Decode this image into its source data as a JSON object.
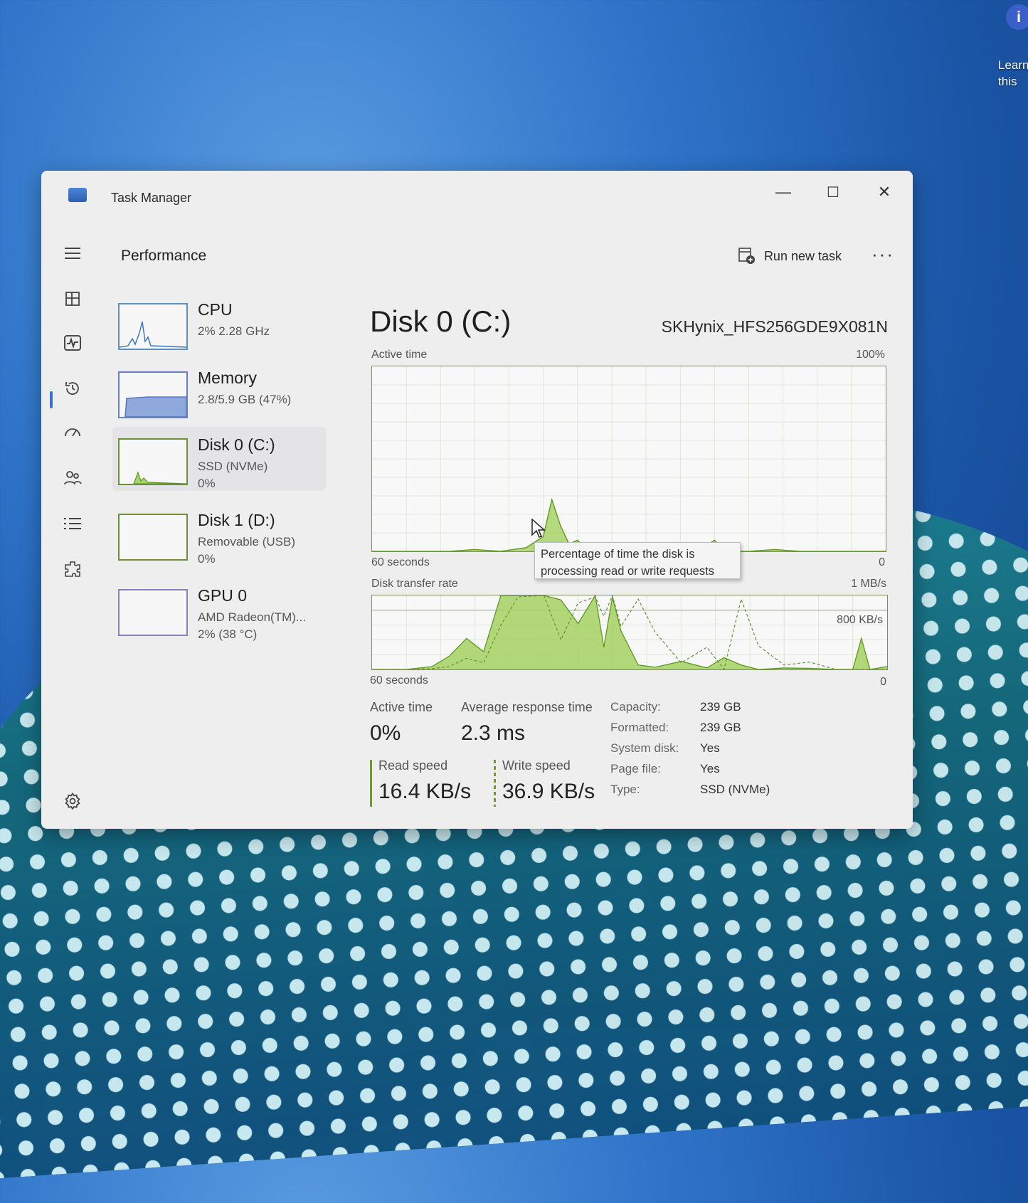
{
  "desktop": {
    "icon": {
      "glyph": "i",
      "label_line1": "Learn",
      "label_line2": "this"
    }
  },
  "window": {
    "title": "Task Manager",
    "controls": {
      "minimize": "—",
      "maximize": "☐",
      "close": "✕"
    }
  },
  "header": {
    "page_title": "Performance",
    "run_new_task": "Run new task",
    "more": "···"
  },
  "nav": {
    "items": [
      "menu-icon",
      "processes-icon",
      "performance-icon",
      "app-history-icon",
      "startup-apps-icon",
      "users-icon",
      "details-icon",
      "services-icon",
      "settings-icon"
    ]
  },
  "resources": [
    {
      "name": "CPU",
      "line1": "2%  2.28 GHz",
      "line2": ""
    },
    {
      "name": "Memory",
      "line1": "2.8/5.9 GB (47%)",
      "line2": ""
    },
    {
      "name": "Disk 0 (C:)",
      "line1": "SSD (NVMe)",
      "line2": "0%"
    },
    {
      "name": "Disk 1 (D:)",
      "line1": "Removable (USB)",
      "line2": "0%"
    },
    {
      "name": "GPU 0",
      "line1": "AMD Radeon(TM)...",
      "line2": "2%  (38 °C)"
    }
  ],
  "detail": {
    "title": "Disk 0 (C:)",
    "model": "SKHynix_HFS256GDE9X081N",
    "active_chart": {
      "label": "Active time",
      "max_label": "100%",
      "x_left": "60 seconds",
      "x_right": "0",
      "tooltip_line1": "Percentage of time the disk is",
      "tooltip_line2": "processing read or write requests"
    },
    "transfer_chart": {
      "label": "Disk transfer rate",
      "max_label": "1 MB/s",
      "ref_label": "800 KB/s",
      "x_left": "60 seconds",
      "x_right": "0"
    },
    "stats": {
      "active_time_label": "Active time",
      "active_time_value": "0%",
      "avg_resp_label": "Average response time",
      "avg_resp_value": "2.3 ms",
      "read_label": "Read speed",
      "read_value": "16.4 KB/s",
      "write_label": "Write speed",
      "write_value": "36.9 KB/s"
    },
    "props": [
      {
        "k": "Capacity:",
        "v": "239 GB"
      },
      {
        "k": "Formatted:",
        "v": "239 GB"
      },
      {
        "k": "System disk:",
        "v": "Yes"
      },
      {
        "k": "Page file:",
        "v": "Yes"
      },
      {
        "k": "Type:",
        "v": "SSD (NVMe)"
      }
    ]
  },
  "chart_data": [
    {
      "type": "area",
      "title": "Active time",
      "ylabel": "%",
      "ylim": [
        0,
        100
      ],
      "x": [
        60,
        57,
        54,
        51,
        48,
        45,
        42,
        40,
        39,
        38,
        37,
        36,
        35,
        33,
        31,
        29,
        27,
        25,
        22,
        20,
        19,
        18,
        16,
        13,
        10,
        7,
        4,
        1,
        0
      ],
      "values": [
        0,
        0,
        0,
        0,
        1,
        0,
        2,
        8,
        28,
        14,
        4,
        6,
        1,
        0,
        3,
        0,
        0,
        1,
        0,
        6,
        1,
        0,
        0,
        1,
        0,
        0,
        0,
        0,
        0
      ],
      "colors": {
        "fill": "#a8d36a",
        "line": "#5c9a1f"
      }
    },
    {
      "type": "area",
      "title": "Disk transfer rate",
      "ylabel": "KB/s",
      "ylim": [
        0,
        1000
      ],
      "reference_line": 800,
      "x": [
        60,
        56,
        53,
        51,
        49,
        47,
        45,
        43,
        40,
        38,
        36,
        34,
        33,
        32,
        31,
        29,
        27,
        24,
        21,
        19,
        17,
        15,
        12,
        9,
        6,
        4,
        3,
        2,
        0
      ],
      "series": [
        {
          "name": "Read",
          "values": [
            0,
            0,
            40,
            180,
            420,
            240,
            1000,
            1000,
            1000,
            940,
            620,
            1000,
            300,
            980,
            520,
            60,
            30,
            110,
            20,
            160,
            60,
            0,
            20,
            15,
            0,
            0,
            420,
            0,
            40
          ]
        },
        {
          "name": "Write",
          "values": [
            0,
            0,
            10,
            40,
            150,
            90,
            600,
            980,
            1000,
            400,
            900,
            980,
            720,
            1000,
            580,
            950,
            500,
            90,
            300,
            0,
            950,
            320,
            60,
            100,
            0,
            0,
            0,
            0,
            0
          ]
        }
      ],
      "colors": {
        "read_fill": "#a8d36a",
        "read_line": "#5c9a1f",
        "write_line": "#6a8f3a"
      }
    }
  ]
}
